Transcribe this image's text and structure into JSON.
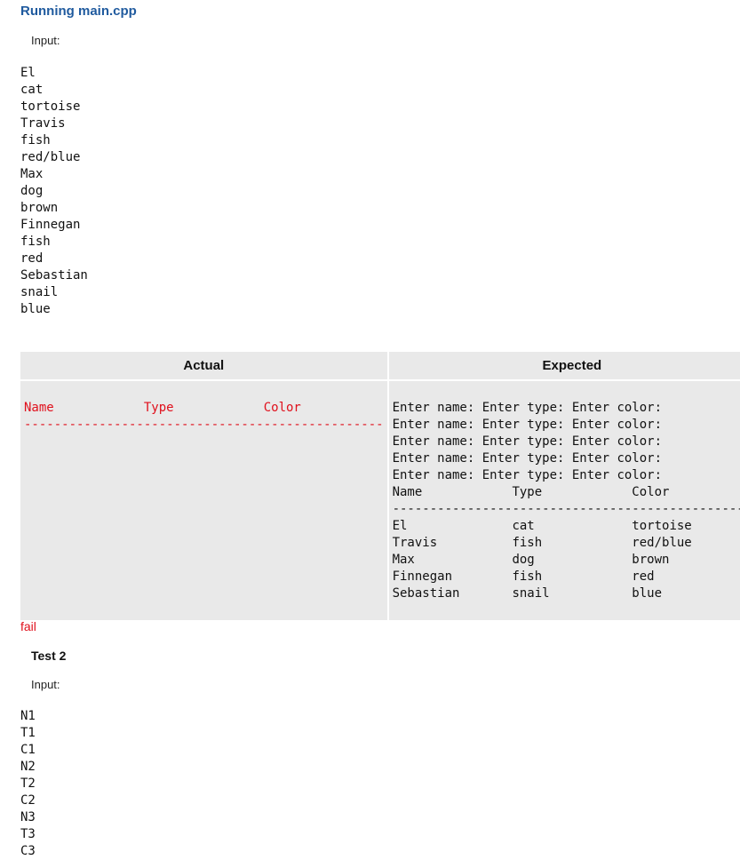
{
  "header": {
    "title": "Running main.cpp"
  },
  "test1": {
    "input_label": "Input:",
    "input_lines": [
      "El",
      "cat",
      "tortoise",
      "Travis",
      "fish",
      "red/blue",
      "Max",
      "dog",
      "brown",
      "Finnegan",
      "fish",
      "red",
      "Sebastian",
      "snail",
      "blue"
    ],
    "comparison": {
      "actual_header": "Actual",
      "expected_header": "Expected",
      "actual_output": "Name            Type            Color\n------------------------------------------------",
      "expected_output": "Enter name: Enter type: Enter color: \nEnter name: Enter type: Enter color: \nEnter name: Enter type: Enter color: \nEnter name: Enter type: Enter color: \nEnter name: Enter type: Enter color: \nName            Type            Color\n------------------------------------------------\nEl              cat             tortoise\nTravis          fish            red/blue\nMax             dog             brown\nFinnegan        fish            red\nSebastian       snail           blue"
    },
    "result": "fail"
  },
  "test2": {
    "title": "Test 2",
    "input_label": "Input:",
    "input_lines": [
      "N1",
      "T1",
      "C1",
      "N2",
      "T2",
      "C2",
      "N3",
      "T3",
      "C3"
    ]
  },
  "colors": {
    "title": "#1f5a9e",
    "fail": "#e0101c",
    "panel_bg": "#e9e9e9"
  }
}
